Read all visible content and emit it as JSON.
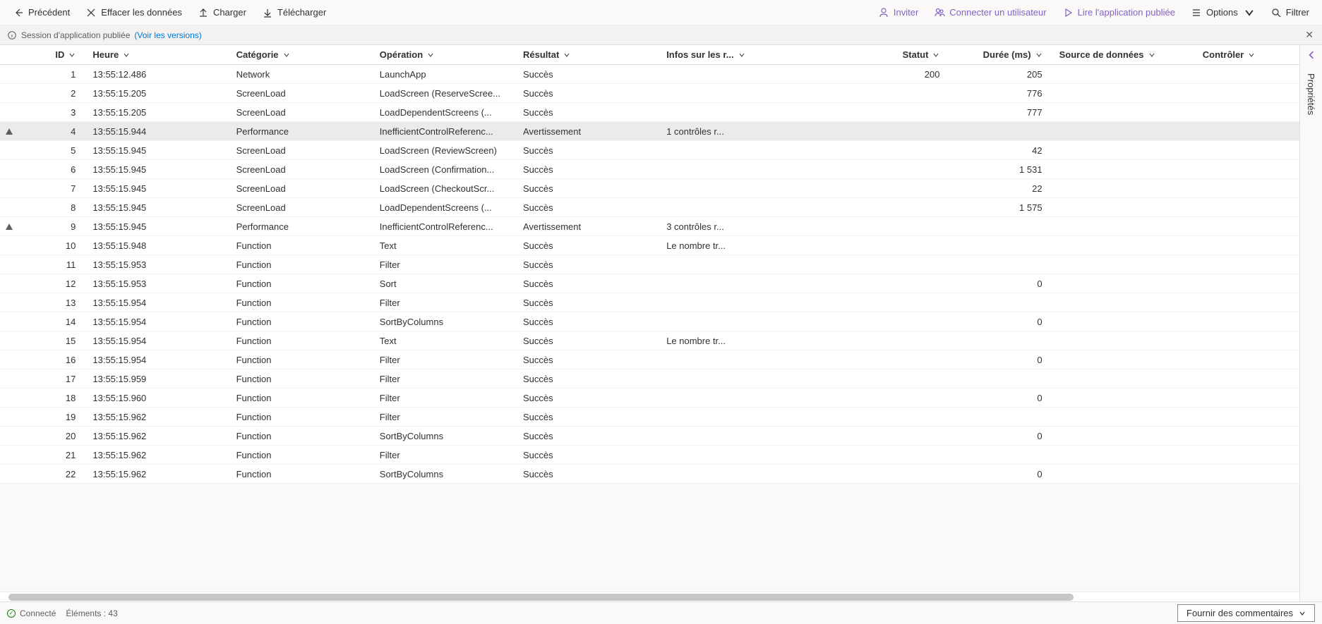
{
  "toolbar": {
    "back": "Précédent",
    "clear": "Effacer les données",
    "upload": "Charger",
    "download": "Télécharger",
    "invite": "Inviter",
    "connectUser": "Connecter un utilisateur",
    "play": "Lire l'application publiée",
    "options": "Options",
    "filter": "Filtrer"
  },
  "banner": {
    "text": "Session d'application publiée",
    "link": "(Voir les versions)"
  },
  "headers": {
    "id": "ID",
    "time": "Heure",
    "category": "Catégorie",
    "operation": "Opération",
    "result": "Résultat",
    "info": "Infos sur les r...",
    "status": "Statut",
    "duration": "Durée (ms)",
    "source": "Source de données",
    "control": "Contrôler"
  },
  "rows": [
    {
      "id": "1",
      "time": "13:55:12.486",
      "cat": "Network",
      "op": "LaunchApp",
      "res": "Succès",
      "info": "",
      "stat": "200",
      "dur": "205",
      "warn": false
    },
    {
      "id": "2",
      "time": "13:55:15.205",
      "cat": "ScreenLoad",
      "op": "LoadScreen (ReserveScree...",
      "res": "Succès",
      "info": "",
      "stat": "",
      "dur": "776",
      "warn": false
    },
    {
      "id": "3",
      "time": "13:55:15.205",
      "cat": "ScreenLoad",
      "op": "LoadDependentScreens (...",
      "res": "Succès",
      "info": "",
      "stat": "",
      "dur": "777",
      "warn": false
    },
    {
      "id": "4",
      "time": "13:55:15.944",
      "cat": "Performance",
      "op": "InefficientControlReferenc...",
      "res": "Avertissement",
      "info": "1 contrôles r...",
      "stat": "",
      "dur": "",
      "warn": true,
      "selected": true
    },
    {
      "id": "5",
      "time": "13:55:15.945",
      "cat": "ScreenLoad",
      "op": "LoadScreen (ReviewScreen)",
      "res": "Succès",
      "info": "",
      "stat": "",
      "dur": "42",
      "warn": false
    },
    {
      "id": "6",
      "time": "13:55:15.945",
      "cat": "ScreenLoad",
      "op": "LoadScreen (Confirmation...",
      "res": "Succès",
      "info": "",
      "stat": "",
      "dur": "1 531",
      "warn": false
    },
    {
      "id": "7",
      "time": "13:55:15.945",
      "cat": "ScreenLoad",
      "op": "LoadScreen (CheckoutScr...",
      "res": "Succès",
      "info": "",
      "stat": "",
      "dur": "22",
      "warn": false
    },
    {
      "id": "8",
      "time": "13:55:15.945",
      "cat": "ScreenLoad",
      "op": "LoadDependentScreens (...",
      "res": "Succès",
      "info": "",
      "stat": "",
      "dur": "1 575",
      "warn": false
    },
    {
      "id": "9",
      "time": "13:55:15.945",
      "cat": "Performance",
      "op": "InefficientControlReferenc...",
      "res": "Avertissement",
      "info": "3 contrôles r...",
      "stat": "",
      "dur": "",
      "warn": true
    },
    {
      "id": "10",
      "time": "13:55:15.948",
      "cat": "Function",
      "op": "Text",
      "res": "Succès",
      "info": "Le nombre tr...",
      "stat": "",
      "dur": "",
      "warn": false
    },
    {
      "id": "11",
      "time": "13:55:15.953",
      "cat": "Function",
      "op": "Filter",
      "res": "Succès",
      "info": "",
      "stat": "",
      "dur": "",
      "warn": false
    },
    {
      "id": "12",
      "time": "13:55:15.953",
      "cat": "Function",
      "op": "Sort",
      "res": "Succès",
      "info": "",
      "stat": "",
      "dur": "0",
      "warn": false
    },
    {
      "id": "13",
      "time": "13:55:15.954",
      "cat": "Function",
      "op": "Filter",
      "res": "Succès",
      "info": "",
      "stat": "",
      "dur": "",
      "warn": false
    },
    {
      "id": "14",
      "time": "13:55:15.954",
      "cat": "Function",
      "op": "SortByColumns",
      "res": "Succès",
      "info": "",
      "stat": "",
      "dur": "0",
      "warn": false
    },
    {
      "id": "15",
      "time": "13:55:15.954",
      "cat": "Function",
      "op": "Text",
      "res": "Succès",
      "info": "Le nombre tr...",
      "stat": "",
      "dur": "",
      "warn": false
    },
    {
      "id": "16",
      "time": "13:55:15.954",
      "cat": "Function",
      "op": "Filter",
      "res": "Succès",
      "info": "",
      "stat": "",
      "dur": "0",
      "warn": false
    },
    {
      "id": "17",
      "time": "13:55:15.959",
      "cat": "Function",
      "op": "Filter",
      "res": "Succès",
      "info": "",
      "stat": "",
      "dur": "",
      "warn": false
    },
    {
      "id": "18",
      "time": "13:55:15.960",
      "cat": "Function",
      "op": "Filter",
      "res": "Succès",
      "info": "",
      "stat": "",
      "dur": "0",
      "warn": false
    },
    {
      "id": "19",
      "time": "13:55:15.962",
      "cat": "Function",
      "op": "Filter",
      "res": "Succès",
      "info": "",
      "stat": "",
      "dur": "",
      "warn": false
    },
    {
      "id": "20",
      "time": "13:55:15.962",
      "cat": "Function",
      "op": "SortByColumns",
      "res": "Succès",
      "info": "",
      "stat": "",
      "dur": "0",
      "warn": false
    },
    {
      "id": "21",
      "time": "13:55:15.962",
      "cat": "Function",
      "op": "Filter",
      "res": "Succès",
      "info": "",
      "stat": "",
      "dur": "",
      "warn": false
    },
    {
      "id": "22",
      "time": "13:55:15.962",
      "cat": "Function",
      "op": "SortByColumns",
      "res": "Succès",
      "info": "",
      "stat": "",
      "dur": "0",
      "warn": false
    }
  ],
  "statusbar": {
    "connected": "Connecté",
    "items": "Éléments : 43",
    "feedback": "Fournir des commentaires"
  },
  "side": {
    "label": "Propriétés"
  }
}
